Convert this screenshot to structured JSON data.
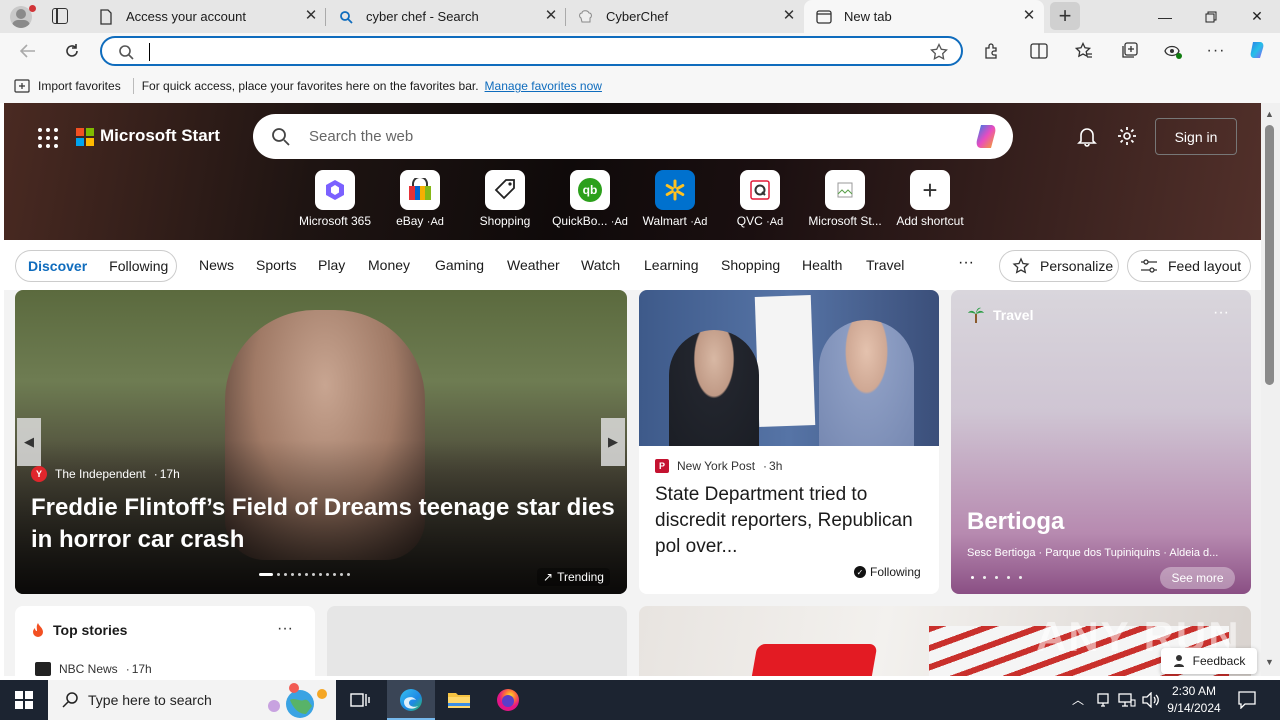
{
  "tabs": [
    {
      "title": "Access your account",
      "icon": "document-icon"
    },
    {
      "title": "cyber chef - Search",
      "icon": "search-icon"
    },
    {
      "title": "CyberChef",
      "icon": "chef-hat-icon"
    },
    {
      "title": "New tab",
      "icon": "new-tab-icon",
      "active": true
    }
  ],
  "address_bar": {
    "value": "",
    "placeholder": ""
  },
  "favorites_bar": {
    "import_label": "Import favorites",
    "message": "For quick access, place your favorites here on the favorites bar.",
    "manage_link": "Manage favorites now"
  },
  "header": {
    "brand": "Microsoft Start",
    "search_placeholder": "Search the web",
    "sign_in": "Sign in"
  },
  "shortcuts": [
    {
      "label": "Microsoft 365",
      "ad": ""
    },
    {
      "label": "eBay",
      "ad": "Ad"
    },
    {
      "label": "Shopping",
      "ad": ""
    },
    {
      "label": "QuickBo...",
      "ad": "Ad"
    },
    {
      "label": "Walmart",
      "ad": "Ad"
    },
    {
      "label": "QVC",
      "ad": "Ad"
    },
    {
      "label": "Microsoft St...",
      "ad": ""
    },
    {
      "label": "Add shortcut",
      "ad": ""
    }
  ],
  "feed_nav": {
    "discover": "Discover",
    "following": "Following",
    "items": [
      "News",
      "Sports",
      "Play",
      "Money",
      "Gaming",
      "Weather",
      "Watch",
      "Learning",
      "Shopping",
      "Health",
      "Travel"
    ],
    "more": "···",
    "personalize": "Personalize",
    "feed_layout": "Feed layout"
  },
  "hero_story": {
    "source": "The Independent",
    "age": "17h",
    "headline": "Freddie Flintoff’s Field of Dreams teenage star dies in horror car crash",
    "trending": "Trending",
    "slide_index": 1,
    "slide_count": 12
  },
  "story2": {
    "source": "New York Post",
    "age": "3h",
    "headline": "State Department tried to discredit reporters, Republican pol over...",
    "following": "Following"
  },
  "travel_card": {
    "category": "Travel",
    "title": "Bertioga",
    "subtitle": "Sesc Bertioga · Parque dos Tupiniquins · Aldeia d...",
    "see_more": "See more"
  },
  "top_stories": {
    "title": "Top stories",
    "first_source": "NBC News",
    "first_age": "17h"
  },
  "feedback": "Feedback",
  "watermark": "ANY RUN",
  "taskbar": {
    "search_placeholder": "Type here to search",
    "time": "2:30 AM",
    "date": "9/14/2024"
  },
  "colors": {
    "accent": "#0f6cbd",
    "taskbar": "#1c2431",
    "ms_red": "#f25022",
    "ms_green": "#7fba00",
    "ms_blue": "#00a4ef",
    "ms_yellow": "#ffb900"
  }
}
